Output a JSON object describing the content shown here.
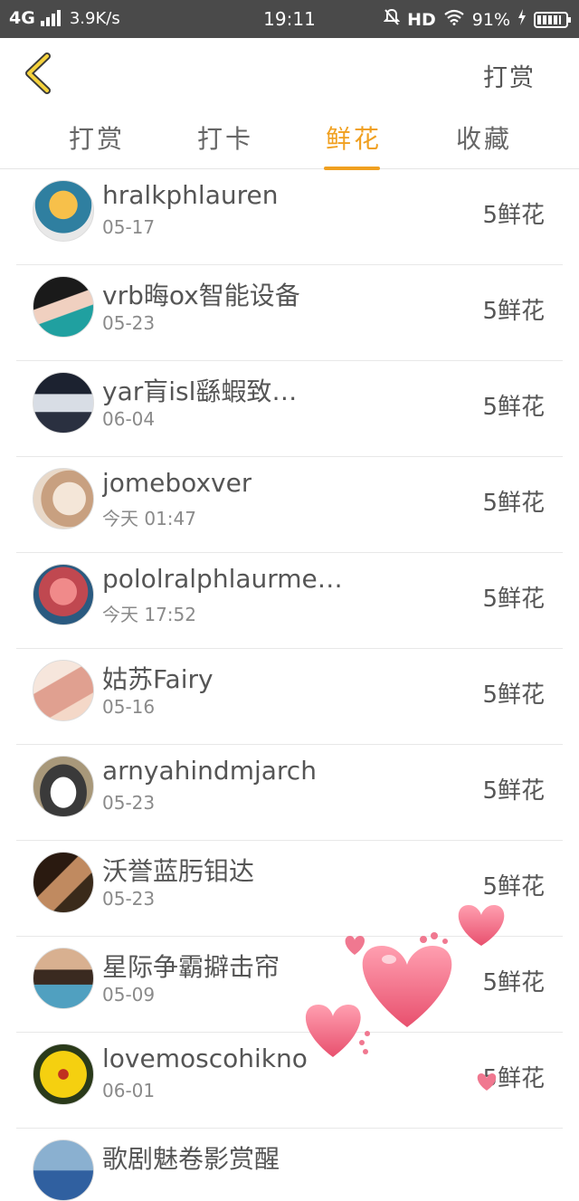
{
  "status_bar": {
    "network": "4G",
    "speed": "3.9K/s",
    "time": "19:11",
    "hd": "HD",
    "battery": "91%",
    "battery_level": 0.91
  },
  "header": {
    "back_icon": "chevron-left-icon",
    "action_label": "打赏"
  },
  "tabs": [
    {
      "label": "打赏",
      "active": false
    },
    {
      "label": "打卡",
      "active": false
    },
    {
      "label": "鲜花",
      "active": true
    },
    {
      "label": "收藏",
      "active": false
    }
  ],
  "colors": {
    "accent": "#f0a020",
    "status_bar": "#4a4a4a",
    "heart": "#f26b86"
  },
  "items": [
    {
      "name": "hralkphlauren",
      "date": "05-17",
      "amount": "5鲜花"
    },
    {
      "name": "vrb晦ox智能设备",
      "date": "05-23",
      "amount": "5鲜花"
    },
    {
      "name": "yar肓isl繇蝦致…",
      "date": "06-04",
      "amount": "5鲜花"
    },
    {
      "name": "jomeboxver",
      "date": "今天 01:47",
      "amount": "5鲜花"
    },
    {
      "name": "pololralphlaurme…",
      "date": "今天 17:52",
      "amount": "5鲜花"
    },
    {
      "name": "姑苏Fairy",
      "date": "05-16",
      "amount": "5鲜花"
    },
    {
      "name": "arnyahindmjarch",
      "date": "05-23",
      "amount": "5鲜花"
    },
    {
      "name": "沃誉蓝肟钼达",
      "date": "05-23",
      "amount": "5鲜花"
    },
    {
      "name": "星际争霸擗击帘",
      "date": "05-09",
      "amount": "5鲜花"
    },
    {
      "name": "lovemoscohikno",
      "date": "06-01",
      "amount": "5鲜花"
    },
    {
      "name": "歌剧魅卷影赏醒",
      "date": "",
      "amount": ""
    }
  ]
}
